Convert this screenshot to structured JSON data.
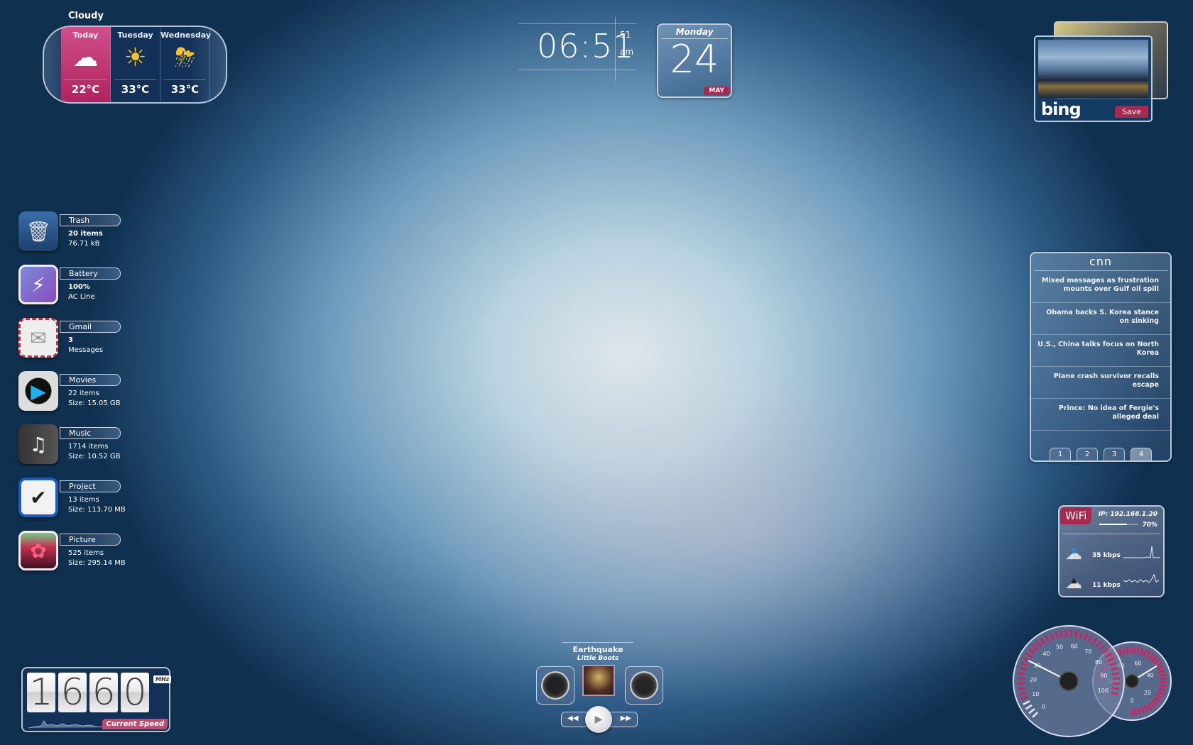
{
  "weather": {
    "condition": "Cloudy",
    "days": [
      {
        "day": "Today",
        "icon": "cloudy-icon",
        "temp": "22°C"
      },
      {
        "day": "Tuesday",
        "icon": "sun-cloud-icon",
        "temp": "33°C"
      },
      {
        "day": "Wednesday",
        "icon": "thunderstorm-icon",
        "temp": "33°C"
      }
    ],
    "accent": "#c0306a"
  },
  "clock": {
    "time": "06:51",
    "seconds": "51",
    "ampm": "am"
  },
  "calendar": {
    "weekday": "Monday",
    "day": "24",
    "month": "MAY"
  },
  "bing": {
    "logo": "bing",
    "save_label": "Save"
  },
  "shortcuts": [
    {
      "label": "Trash",
      "line1": "20 items",
      "line2": "76.71 kB",
      "icon": "trash-icon"
    },
    {
      "label": "Battery",
      "line1": "100%",
      "line2": "AC Line",
      "icon": "battery-bolt-icon"
    },
    {
      "label": "Gmail",
      "line1": "3",
      "line2": "Messages",
      "icon": "mail-envelope-icon"
    },
    {
      "label": "Movies",
      "line1": "22 items",
      "line2": "Size: 15.05 GB",
      "icon": "play-icon"
    },
    {
      "label": "Music",
      "line1": "1714 items",
      "line2": "Size: 10.52 GB",
      "icon": "music-note-icon"
    },
    {
      "label": "Project",
      "line1": "13 items",
      "line2": "Size: 113.70 MB",
      "icon": "checkmark-icon"
    },
    {
      "label": "Picture",
      "line1": "525 items",
      "line2": "Size: 295.14 MB",
      "icon": "picture-icon"
    }
  ],
  "cnn": {
    "title": "CNN",
    "headlines": [
      "Mixed messages as frustration mounts over Gulf oil spill",
      "Obama backs S. Korea stance on sinking",
      "U.S., China talks focus on North Korea",
      "Plane crash survivor recalls escape",
      "Prince: No idea of Fergie's alleged deal"
    ],
    "pages": [
      "1",
      "2",
      "3",
      "4"
    ],
    "active_page": "4"
  },
  "wifi": {
    "label": "WiFi",
    "ip": "IP: 192.168.1.20",
    "signal": "70%",
    "signal_value": 70,
    "download": "35 kbps",
    "upload": "11 kbps"
  },
  "gauges": {
    "big_ticks": [
      "0",
      "10",
      "20",
      "30",
      "40",
      "50",
      "60",
      "70",
      "80",
      "90",
      "100"
    ],
    "big_value": 30,
    "small_ticks": [
      "0",
      "20",
      "40",
      "60",
      "80",
      "100"
    ],
    "small_value": 45,
    "accent": "#e0185c"
  },
  "cpu": {
    "digits": [
      "1",
      "6",
      "6",
      "0"
    ],
    "unit": "MHz",
    "label": "Current Speed"
  },
  "music": {
    "title": "Earthquake",
    "artist": "Little Boots"
  }
}
